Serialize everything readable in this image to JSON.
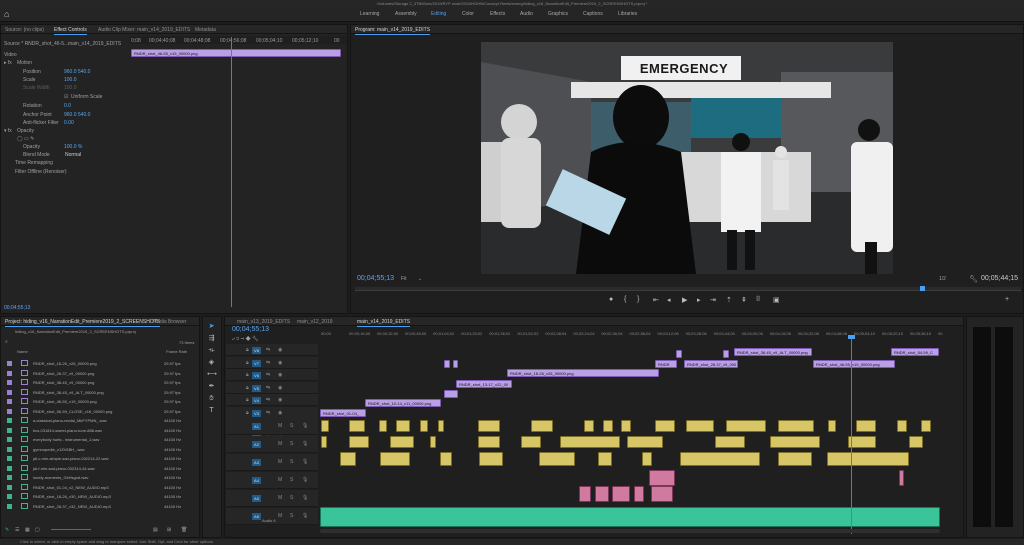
{
  "title_bar": "/Volumes/Storage 2_3TB/Work/2019/RYP work/2019/HDHN/Concept Reels/emerg/hiding_v16_NarrationEdit_Premiere2019_2_SCREENSHOTS.prproj *",
  "workspaces": [
    "Learning",
    "Assembly",
    "Editing",
    "Color",
    "Effects",
    "Audio",
    "Graphics",
    "Captions",
    "Libraries"
  ],
  "active_workspace": "Editing",
  "source_panel": {
    "tabs": [
      "Source: (no clips)",
      "Effect Controls",
      "Audio Clip Mixer: main_v14_2019_EDITS",
      "Metadata"
    ],
    "active_tab": "Effect Controls",
    "source_label": "Source * RNDR_shot_46-5...",
    "sequence_label": "main_v14_2019_EDITS",
    "clip_name": "RNDR_shot_46-55_v19_00000.png",
    "timecodes": [
      "0;08",
      "00;04;40;08",
      "00;04;48;08",
      "00;04;56;08",
      "00;05;04;10",
      "00;05;12;10",
      "00"
    ],
    "section_video": "Video",
    "props": [
      {
        "label": "Motion",
        "value": ""
      },
      {
        "label": "Position",
        "value": "960.0   540.0"
      },
      {
        "label": "Scale",
        "value": "100.0"
      },
      {
        "label": "Scale Width",
        "value": "100.0"
      },
      {
        "label": "Uniform Scale",
        "value": ""
      },
      {
        "label": "Rotation",
        "value": "0.0"
      },
      {
        "label": "Anchor Point",
        "value": "960.0   540.0"
      },
      {
        "label": "Anti-flicker Filter",
        "value": "0.00"
      },
      {
        "label": "Opacity",
        "value": ""
      },
      {
        "label": "Opacity",
        "value": "100.0 %"
      },
      {
        "label": "Blend Mode",
        "value": "Normal"
      },
      {
        "label": "Time Remapping",
        "value": ""
      },
      {
        "label": "Filter Offline (Renoiser)",
        "value": ""
      }
    ],
    "footer_tc": "00;04;55;13"
  },
  "program_monitor": {
    "title": "Program: main_v14_2019_EDITS",
    "sign_text": "EMERGENCY",
    "timecode": "00;04;55;13",
    "fit": "Fit",
    "ratio": "1/2",
    "duration": "00;05;44;15"
  },
  "project_panel": {
    "tabs": [
      "Project: hiding_v16_NarrationEdit_Premiere2019_2_SCREENSHOTS",
      "Media Browser"
    ],
    "path": "hiding_v16_NarrationEdit_Premiere2019_2_SCREENSHOTS.prproj",
    "item_count": "73 Items",
    "col_name": "Name",
    "col_frame": "Frame Rate",
    "items": [
      {
        "name": "RNDR_shot_18-26_v26_00000.png",
        "rate": "29.97 fps",
        "color": "#9b7fd4"
      },
      {
        "name": "RNDR_shot_28-37_v9_00000.png",
        "rate": "29.97 fps",
        "color": "#9b7fd4"
      },
      {
        "name": "RNDR_shot_38-45_v9_00000.png",
        "rate": "29.97 fps",
        "color": "#9b7fd4"
      },
      {
        "name": "RNDR_shot_38-45_v9_ALT_00000.png",
        "rate": "29.97 fps",
        "color": "#9b7fd4"
      },
      {
        "name": "RNDR_shot_46-55_v19_00000.png",
        "rate": "29.97 fps",
        "color": "#9b7fd4"
      },
      {
        "name": "RNDR_shot_56-59_CLOSE_v16_00000.png",
        "rate": "29.97 fps",
        "color": "#9b7fd4"
      },
      {
        "name": "a-classical-piano-recital_MkFYPMN_.wav",
        "rate": "44100 Hz",
        "color": "#3fb48b"
      },
      {
        "name": "bcs-031814-sweet-piano-tune-886.wav",
        "rate": "44100 Hz",
        "color": "#3fb48b"
      },
      {
        "name": "everybody hurts - instrumental_1.wav",
        "rate": "44100 Hz",
        "color": "#3fb48b"
      },
      {
        "name": "gymnopedie_z1ZhSBH_.wav",
        "rate": "44100 Hz",
        "color": "#3fb48b"
      },
      {
        "name": "jdi-c-min-simple-sad-piano-032214-22.wav",
        "rate": "44100 Hz",
        "color": "#3fb48b"
      },
      {
        "name": "jdi-f-min-sad-piano-032314-44.wav",
        "rate": "44100 Hz",
        "color": "#3fb48b"
      },
      {
        "name": "lonely-moments_GkHsgnd.wav",
        "rate": "44100 Hz",
        "color": "#3fb48b"
      },
      {
        "name": "RNDR_shot_01-04_v2_NEW_AUDIO.mp3",
        "rate": "44100 Hz",
        "color": "#3fb48b"
      },
      {
        "name": "RNDR_shot_18-26_v30_NEW_AUDIO.mp3",
        "rate": "44100 Hz",
        "color": "#3fb48b"
      },
      {
        "name": "RNDR_shot_28-37_v32_NEW_AUDIO.mp3",
        "rate": "44100 Hz",
        "color": "#3fb48b"
      }
    ]
  },
  "timeline": {
    "tabs": [
      "main_v13_2019_EDITS",
      "main_v12_2019",
      "main_v14_2019_EDITS"
    ],
    "active_tab": "main_v14_2019_EDITS",
    "timecode": "00;04;55;13",
    "ruler": [
      "00;00",
      "00;00;16;00",
      "00;00;32;00",
      "00;00;48;00",
      "00;01;04;02",
      "00;01;20;02",
      "00;01;36;02",
      "00;01;52;02",
      "00;02;08;04",
      "00;02;24;04",
      "00;02;40;04",
      "00;02;56;04",
      "00;03;12;06",
      "00;03;28;06",
      "00;03;44;06",
      "00;04;00;06",
      "00;04;16;08",
      "00;04;32;08",
      "00;04;48;08",
      "00;05;04;10",
      "00;05;20;10",
      "00;05;36;10",
      "00"
    ],
    "video_tracks": [
      "V8",
      "V7",
      "V6",
      "V5",
      "V4",
      "V3",
      "V2",
      "V1"
    ],
    "audio_tracks": [
      "A1",
      "A2",
      "A3",
      "A4",
      "A5",
      "A6"
    ],
    "audio6_label": "Audio 6",
    "video_clips": [
      {
        "label": "RNDR_shot_38-45_v9_ALT_00000.png"
      },
      {
        "label": "RNDR_shot_54-59_C"
      },
      {
        "label": "RNDR"
      },
      {
        "label": "RNDR_shot_28-37_v9_000"
      },
      {
        "label": "RNDR_shot_46-55_v19_00000.png"
      },
      {
        "label": "RNDR_shot_18-26_v26_00000.png"
      },
      {
        "label": "RNDR_shot_13-17_v22_00"
      },
      {
        "label": "RNDR_shot_10-14_v11_00000.png"
      },
      {
        "label": "RNDR_shot_01-04_"
      }
    ]
  },
  "status_bar": "Click to select, or click in empty space and drag to marquee select. Use Shift, Opt, and Cmd for other options."
}
